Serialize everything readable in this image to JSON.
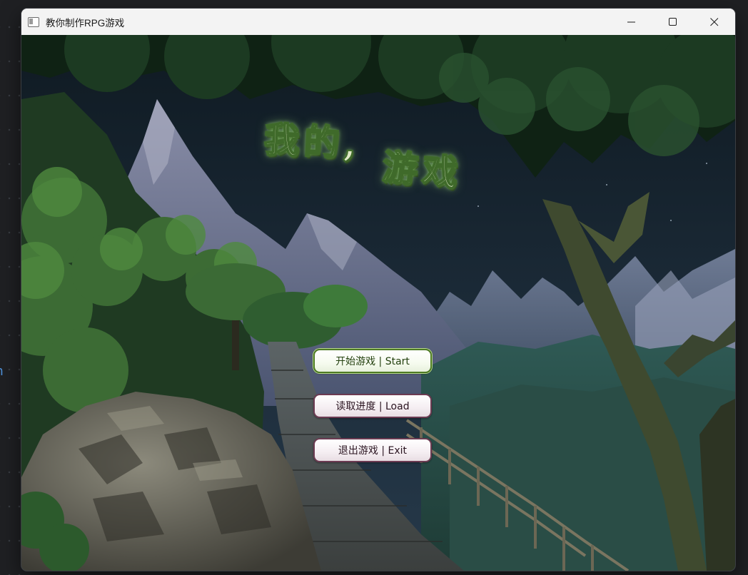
{
  "window": {
    "title": "教你制作RPG游戏",
    "controls": {
      "minimize": "minimize-icon",
      "maximize": "maximize-icon",
      "close": "close-icon"
    }
  },
  "game": {
    "logo_line1": "我的,",
    "logo_line2": "游戏",
    "menu": [
      {
        "label": "开始游戏 | Start",
        "active": true
      },
      {
        "label": "读取进度 | Load",
        "active": false
      },
      {
        "label": "退出游戏 | Exit",
        "active": false
      }
    ]
  },
  "colors": {
    "titlebar": "#f3f3f3",
    "button_border_default": "#6c3b52",
    "button_border_active": "#4d7a22",
    "logo_fill": "#dfe8c7",
    "logo_stroke": "#3f6a2a"
  }
}
